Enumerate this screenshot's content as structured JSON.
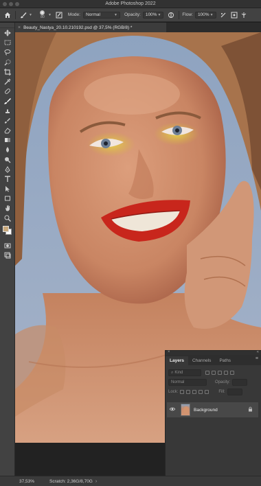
{
  "app": {
    "title": "Adobe Photoshop 2022"
  },
  "options_bar": {
    "brush_size": "80",
    "mode_label": "Mode:",
    "mode_value": "Normal",
    "opacity_label": "Opacity:",
    "opacity_value": "100%",
    "flow_label": "Flow:",
    "flow_value": "100%"
  },
  "document": {
    "tab_title": "Beauty_Nastya_20.10.210192.psd @ 37,5% (RGB/8) *"
  },
  "colors": {
    "foreground": "#c8a87a",
    "background": "#ffffff",
    "ui_panel": "#424242",
    "lipstick": "#c8261c",
    "eyeshadow": "#d8c23a"
  },
  "tools": [
    "move-tool",
    "marquee-tool",
    "lasso-tool",
    "quick-selection-tool",
    "crop-tool",
    "eyedropper-tool",
    "healing-brush-tool",
    "brush-tool",
    "clone-stamp-tool",
    "history-brush-tool",
    "eraser-tool",
    "gradient-tool",
    "blur-tool",
    "dodge-tool",
    "pen-tool",
    "type-tool",
    "path-selection-tool",
    "rectangle-tool",
    "hand-tool",
    "zoom-tool"
  ],
  "layers_panel": {
    "tabs": [
      {
        "label": "Layers",
        "active": true
      },
      {
        "label": "Channels",
        "active": false
      },
      {
        "label": "Paths",
        "active": false
      }
    ],
    "filter_label": "Kind",
    "blend_mode": "Normal",
    "opacity_label": "Opacity:",
    "lock_label": "Lock:",
    "fill_label": "Fill:",
    "layers": [
      {
        "name": "Background",
        "visible": true,
        "locked": true
      }
    ]
  },
  "status": {
    "zoom": "37,53%",
    "scratch": "Scratch: 2,36G/8,70G"
  }
}
